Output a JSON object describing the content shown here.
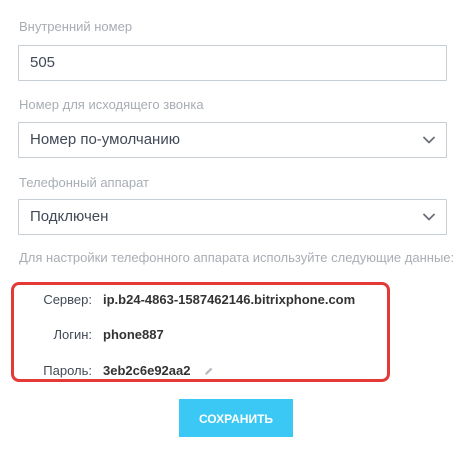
{
  "extension": {
    "label": "Внутренний номер",
    "value": "505"
  },
  "outgoing_number": {
    "label": "Номер для исходящего звонка",
    "selected": "Номер по-умолчанию"
  },
  "phone_device": {
    "label": "Телефонный аппарат",
    "selected": "Подключен"
  },
  "hint": "Для настройки телефонного аппарата используйте следующие данные:",
  "credentials": {
    "server_label": "Сервер:",
    "server_value": "ip.b24-4863-1587462146.bitrixphone.com",
    "login_label": "Логин:",
    "login_value": "phone887",
    "password_label": "Пароль:",
    "password_value": "3eb2c6e92aa2",
    "highlight_color": "#e53935"
  },
  "save_button": {
    "label": "СОХРАНИТЬ",
    "color": "#3bc8f5"
  },
  "icons": {
    "dropdown": "chevron-down-icon",
    "edit": "pencil-icon"
  }
}
